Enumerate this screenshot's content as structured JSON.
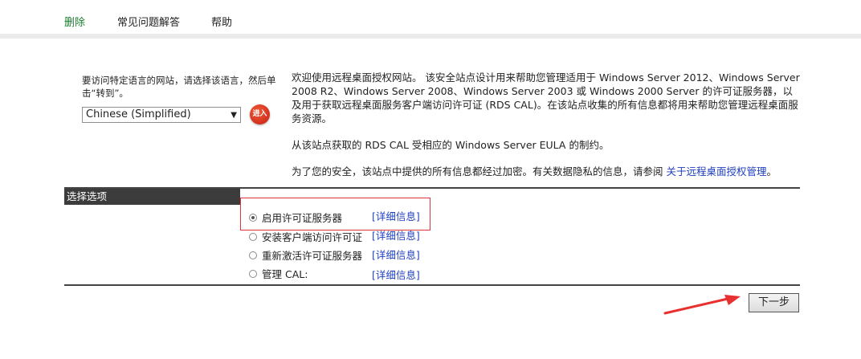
{
  "nav": {
    "items": [
      {
        "label": "删除"
      },
      {
        "label": "常见问题解答"
      },
      {
        "label": "帮助"
      }
    ]
  },
  "language": {
    "prompt": "要访问特定语言的网站，请选择该语言，然后单击“转到”。",
    "selected": "Chinese (Simplified)",
    "go_button": "进入"
  },
  "intro": {
    "paragraph1": "欢迎使用远程桌面授权网站。 该安全站点设计用来帮助您管理适用于 Windows Server 2012、Windows Server 2008 R2、Windows Server 2008、Windows Server 2003 或 Windows 2000 Server 的许可证服务器，以及用于获取远程桌面服务客户端访问许可证 (RDS CAL)。在该站点收集的所有信息都将用来帮助您管理远程桌面服务资源。",
    "paragraph2": "从该站点获取的 RDS CAL 受相应的 Windows Server EULA 的制约。",
    "paragraph3_prefix": "为了您的安全，该站点中提供的所有信息都经过加密。有关数据隐私的信息，请参阅 ",
    "paragraph3_link": "关于远程桌面授权管理",
    "paragraph3_suffix": "。"
  },
  "options": {
    "header": "选择选项",
    "items": [
      {
        "label": "启用许可证服务器",
        "detail": "[详细信息]",
        "checked": true
      },
      {
        "label": "安装客户端访问许可证",
        "detail": "[详细信息]",
        "checked": false
      },
      {
        "label": "重新激活许可证服务器",
        "detail": "[详细信息]",
        "checked": false
      },
      {
        "label": "管理 CAL:",
        "detail": "[详细信息]",
        "checked": false
      }
    ]
  },
  "next_button": "下一步",
  "colors": {
    "nav_active": "#1a7f2e",
    "link": "#1f3fbf",
    "highlight_box": "#e0343c",
    "annotation_arrow": "#e8312f"
  }
}
